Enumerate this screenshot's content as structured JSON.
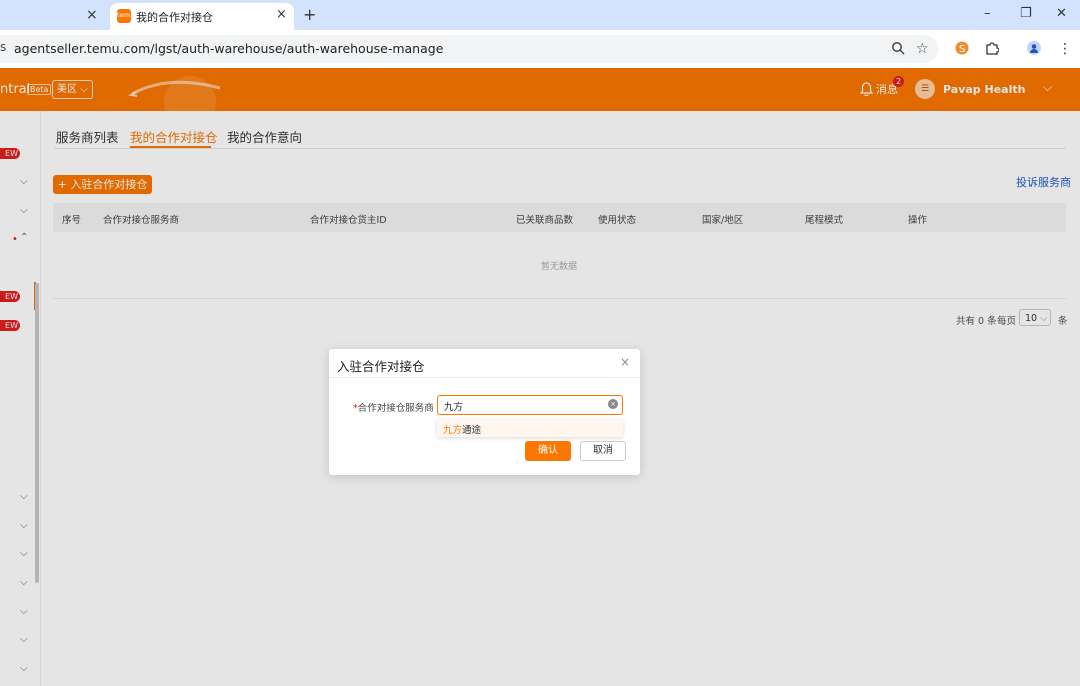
{
  "browser": {
    "tab_prev_close": "×",
    "active_tab": {
      "favicon": "temu",
      "title": "我的合作对接仓",
      "close": "×"
    },
    "new_tab": "+",
    "window_controls": {
      "minimize": "–",
      "restore": "❐",
      "close": "✕"
    },
    "url_partial_prefix": "s",
    "url": "agentseller.temu.com/lgst/auth-warehouse/auth-warehouse-manage",
    "icons": [
      "zoom-icon",
      "bookmark-star-icon",
      "extension-s-icon",
      "puzzle-icon",
      "profile-icon",
      "kebab-menu-icon"
    ]
  },
  "header": {
    "brand_fragment": "ntral",
    "beta": "Beta",
    "region": "美区",
    "messages_label": "消息",
    "messages_count": "2",
    "username": "Pavap Health",
    "accent": "#fb7701"
  },
  "sidebar": {
    "new_badges": [
      "EW",
      "EW",
      "EW"
    ]
  },
  "content": {
    "tabs": [
      {
        "label": "服务商列表",
        "active": false
      },
      {
        "label": "我的合作对接仓",
        "active": true
      },
      {
        "label": "我的合作意向",
        "active": false
      }
    ],
    "add_button": "+ 入驻合作对接仓",
    "complain_link": "投诉服务商",
    "table": {
      "columns": [
        "序号",
        "合作对接仓服务商",
        "合作对接仓货主ID",
        "已关联商品数",
        "使用状态",
        "国家/地区",
        "尾程模式",
        "操作"
      ],
      "empty_text": "暂无数据"
    },
    "pagination": {
      "total": "共有 0 条",
      "per_page_label": "每页",
      "per_page_value": "10",
      "unit": "条"
    }
  },
  "modal": {
    "title": "入驻合作对接仓",
    "close": "×",
    "field_required_mark": "*",
    "field_label": "合作对接仓服务商",
    "field_value": "九方",
    "suggestion_highlight": "九方",
    "suggestion_rest": "通途",
    "confirm": "确认",
    "cancel": "取消"
  }
}
